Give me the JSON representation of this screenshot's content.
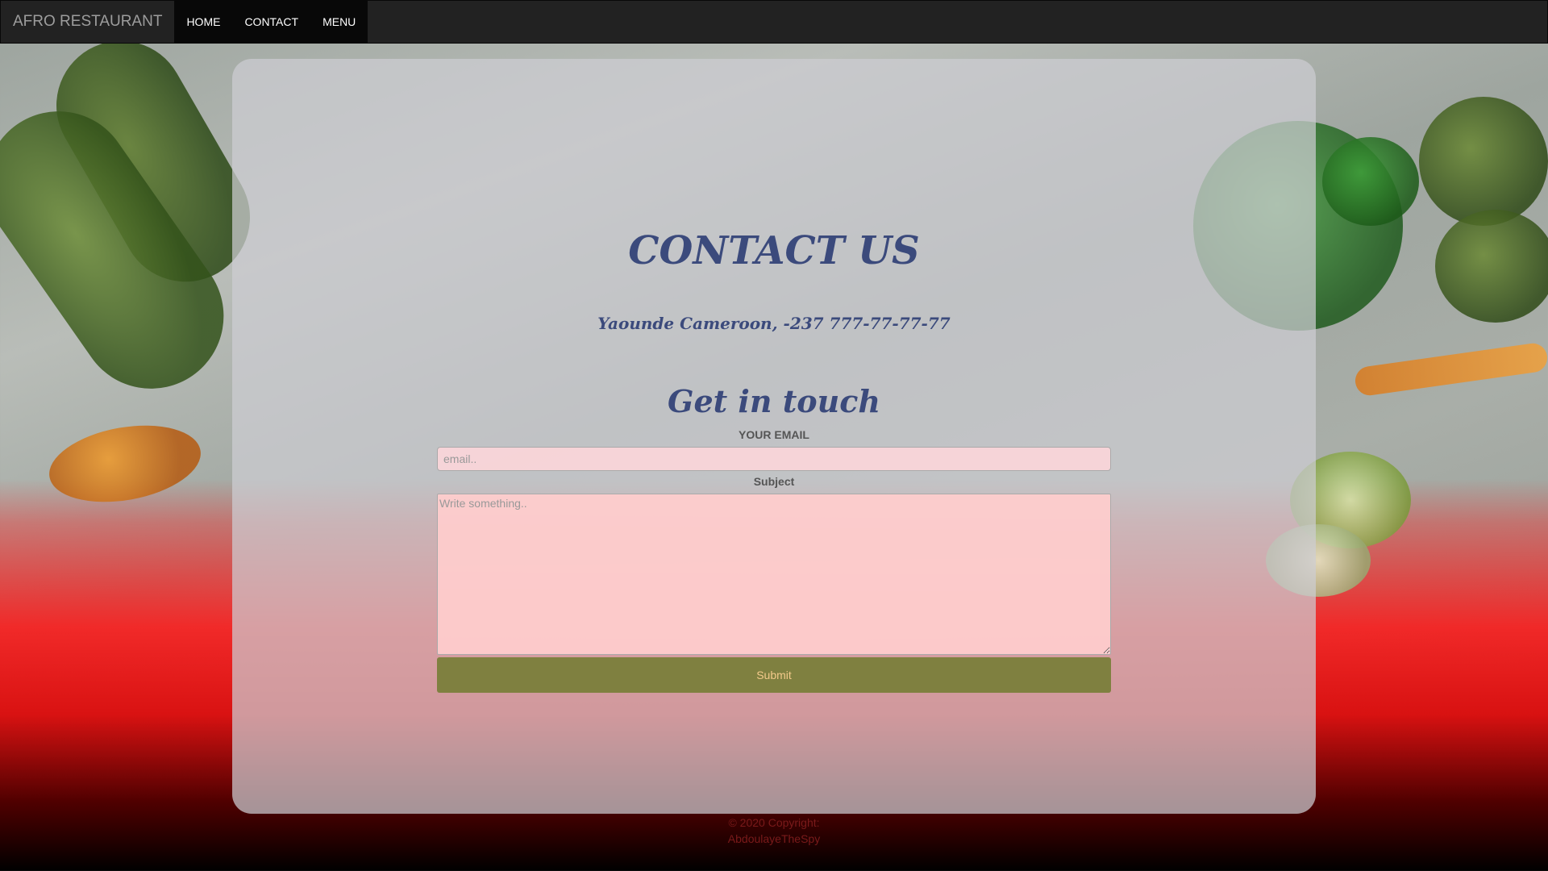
{
  "navbar": {
    "brand": "AFRO RESTAURANT",
    "links": [
      {
        "label": "HOME"
      },
      {
        "label": "CONTACT"
      },
      {
        "label": "MENU"
      }
    ]
  },
  "main": {
    "title": "CONTACT US",
    "address": "Yaounde Cameroon, -237 777-77-77-77",
    "subtitle": "Get in touch",
    "form": {
      "email_label": "YOUR EMAIL",
      "email_placeholder": "email..",
      "email_value": "",
      "subject_label": "Subject",
      "message_placeholder": "Write something..",
      "message_value": "",
      "submit_label": "Submit"
    }
  },
  "footer": {
    "line1": "© 2020 Copyright:",
    "line2": "AbdoulayeTheSpy"
  },
  "colors": {
    "navbar_bg": "#222222",
    "heading": "#3b4a7c",
    "submit_bg": "#7f8040",
    "submit_text": "#f2c98a",
    "field_bg": "#ffd7da"
  }
}
